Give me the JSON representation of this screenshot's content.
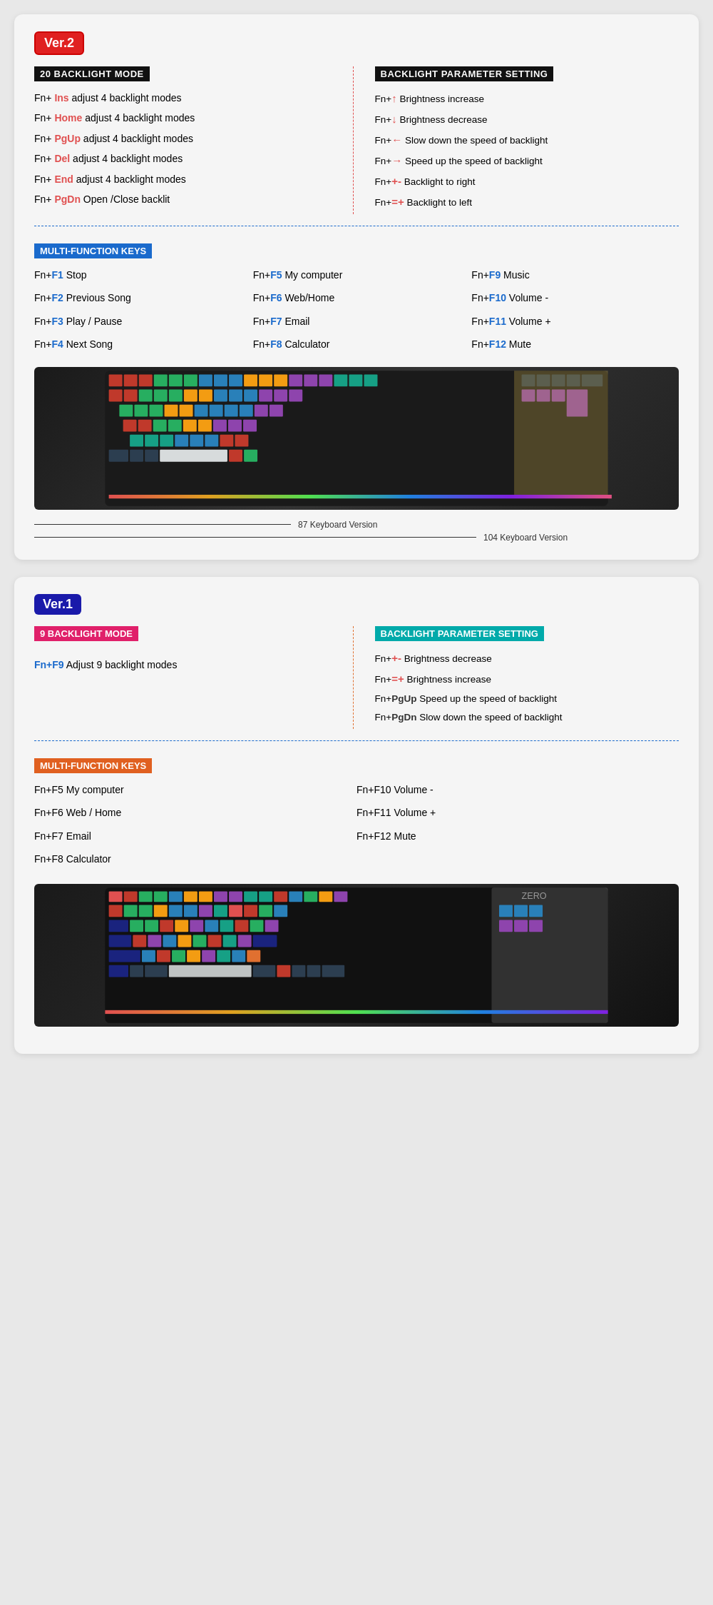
{
  "v2": {
    "badge": "Ver.2",
    "backlight_header": "20 BACKLIGHT MODE",
    "param_header": "BACKLIGHT PARAMETER SETTING",
    "backlight_rows": [
      {
        "prefix": "Fn+",
        "key": "Ins",
        "text": " adjust 4 backlight modes"
      },
      {
        "prefix": "Fn+",
        "key": "Home",
        "text": " adjust 4 backlight modes"
      },
      {
        "prefix": "Fn+",
        "key": "PgUp",
        "text": " adjust 4 backlight modes"
      },
      {
        "prefix": "Fn+",
        "key": "Del",
        "text": " adjust 4 backlight modes"
      },
      {
        "prefix": "Fn+",
        "key": "End",
        "text": " adjust 4 backlight modes"
      },
      {
        "prefix": "Fn+",
        "key": "PgDn",
        "text": " Open /Close backlit"
      }
    ],
    "param_rows": [
      {
        "prefix": "Fn+",
        "sym": "↑",
        "text": " Brightness increase"
      },
      {
        "prefix": "Fn+",
        "sym": "↓",
        "text": " Brightness decrease"
      },
      {
        "prefix": "Fn+",
        "sym": "←",
        "text": " Slow down the speed of backlight"
      },
      {
        "prefix": "Fn+",
        "sym": "→",
        "text": " Speed up the speed of backlight"
      },
      {
        "prefix": "Fn+",
        "sym": "+-",
        "text": "  Backlight to right"
      },
      {
        "prefix": "Fn+",
        "sym": "=+",
        "text": "  Backlight to left"
      }
    ],
    "multi_header": "MULTI-FUNCTION KEYS",
    "multi_keys": [
      {
        "prefix": "Fn+",
        "key": "F1",
        "text": " Stop"
      },
      {
        "prefix": "Fn+",
        "key": "F5",
        "text": " My computer"
      },
      {
        "prefix": "Fn+",
        "key": "F9",
        "text": "  Music"
      },
      {
        "prefix": "Fn+",
        "key": "F2",
        "text": " Previous Song"
      },
      {
        "prefix": "Fn+",
        "key": "F6",
        "text": " Web/Home"
      },
      {
        "prefix": "Fn+",
        "key": "F10",
        "text": " Volume -"
      },
      {
        "prefix": "Fn+",
        "key": "F3",
        "text": " Play / Pause"
      },
      {
        "prefix": "Fn+",
        "key": "F7",
        "text": " Email"
      },
      {
        "prefix": "Fn+",
        "key": "F11",
        "text": " Volume +"
      },
      {
        "prefix": "Fn+",
        "key": "F4",
        "text": " Next Song"
      },
      {
        "prefix": "Fn+",
        "key": "F8",
        "text": " Calculator"
      },
      {
        "prefix": "Fn+",
        "key": "F12",
        "text": " Mute"
      }
    ],
    "keyboard_87": "87 Keyboard Version",
    "keyboard_104": "104 Keyboard Version"
  },
  "v1": {
    "badge": "Ver.1",
    "backlight_header": "9 BACKLIGHT MODE",
    "param_header": "BACKLIGHT PARAMETER SETTING",
    "backlight_rows": [
      {
        "prefix": "Fn+F9",
        "text": " Adjust 9 backlight modes"
      }
    ],
    "param_rows": [
      {
        "prefix": "Fn+",
        "sym": "+-",
        "text": "  Brightness decrease"
      },
      {
        "prefix": "Fn+",
        "sym": "=+",
        "text": "  Brightness increase"
      },
      {
        "prefix": "Fn+",
        "sym": "PgUp",
        "text": " Speed up the speed of backlight"
      },
      {
        "prefix": "Fn+",
        "sym": "PgDn",
        "text": " Slow down the speed of backlight"
      }
    ],
    "multi_header": "MULTI-FUNCTION KEYS",
    "multi_keys_left": [
      {
        "prefix": "Fn+F5",
        "text": " My computer"
      },
      {
        "prefix": "Fn+F6",
        "text": " Web / Home"
      },
      {
        "prefix": "Fn+F7",
        "text": " Email"
      },
      {
        "prefix": "Fn+F8",
        "text": " Calculator"
      }
    ],
    "multi_keys_right": [
      {
        "prefix": "Fn+F10",
        "text": "  Volume -"
      },
      {
        "prefix": "Fn+F11",
        "text": "  Volume +"
      },
      {
        "prefix": "Fn+F12",
        "text": "  Mute"
      }
    ]
  }
}
